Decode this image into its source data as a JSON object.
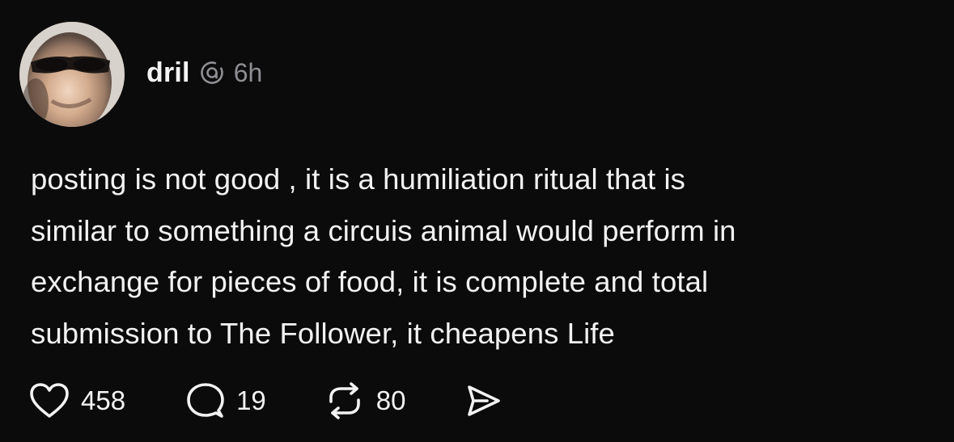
{
  "author": {
    "username": "dril",
    "timestamp": "6h",
    "badge_icon": "threads-icon"
  },
  "post": {
    "text": "posting is not good , it is a humiliation ritual that is\nsimilar to something a circuis animal would perform in\nexchange for pieces of food, it is complete and total\nsubmission to The Follower, it cheapens Life"
  },
  "actions": {
    "likes": "458",
    "replies": "19",
    "reposts": "80",
    "like_icon": "heart-icon",
    "reply_icon": "comment-icon",
    "repost_icon": "repost-icon",
    "share_icon": "send-icon"
  },
  "colors": {
    "background": "#0b0b0c",
    "text": "#f2f2f2",
    "muted": "#8e8e93"
  }
}
